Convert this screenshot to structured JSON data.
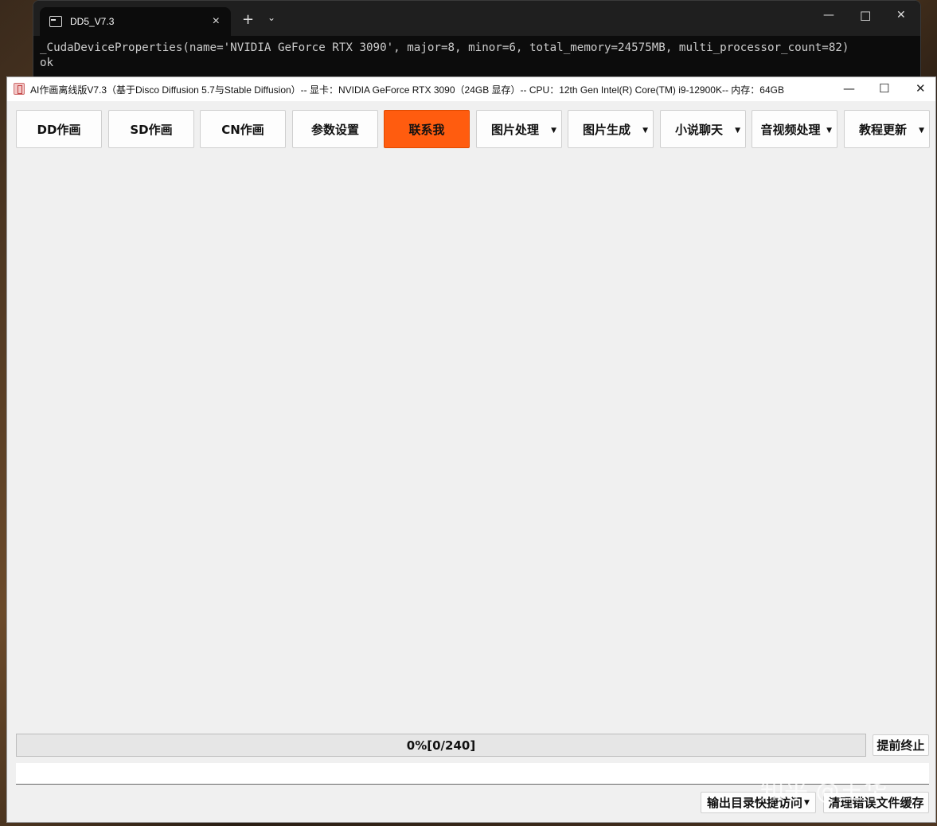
{
  "terminal": {
    "tab_title": "DD5_V7.3",
    "new_tab": "+",
    "dropdown": "⌄",
    "controls": {
      "minimize": "—",
      "maximize": "☐",
      "close": "✕"
    },
    "output_lines": [
      "_CudaDeviceProperties(name='NVIDIA GeForce RTX 3090', major=8, minor=6, total_memory=24575MB, multi_processor_count=82)",
      "ok"
    ]
  },
  "app": {
    "title": "AI作画离线版V7.3（基于Disco Diffusion 5.7与Stable Diffusion）-- 显卡：NVIDIA GeForce RTX 3090（24GB 显存）-- CPU：12th Gen Intel(R) Core(TM) i9-12900K-- 内存：64GB",
    "controls": {
      "minimize": "—",
      "maximize": "☐",
      "close": "✕"
    },
    "tabs": [
      {
        "label": "DD作画",
        "dropdown": false,
        "active": false
      },
      {
        "label": "SD作画",
        "dropdown": false,
        "active": false
      },
      {
        "label": "CN作画",
        "dropdown": false,
        "active": false
      },
      {
        "label": "参数设置",
        "dropdown": false,
        "active": false
      },
      {
        "label": "联系我",
        "dropdown": false,
        "active": true
      },
      {
        "label": "图片处理",
        "dropdown": true,
        "active": false
      },
      {
        "label": "图片生成",
        "dropdown": true,
        "active": false
      },
      {
        "label": "小说聊天",
        "dropdown": true,
        "active": false
      },
      {
        "label": "音视频处理",
        "dropdown": true,
        "active": false
      },
      {
        "label": "教程更新",
        "dropdown": true,
        "active": false
      }
    ],
    "accent_color": "#ff5c0f",
    "progress": {
      "text": "0%[0/240]",
      "fraction": 0
    },
    "stop_button": "提前终止",
    "log_text": "",
    "bottom_buttons": {
      "output_dir": "输出目录快捷访问",
      "clear_cache": "清理错误文件缓存"
    }
  },
  "watermark": "知乎 @王华"
}
